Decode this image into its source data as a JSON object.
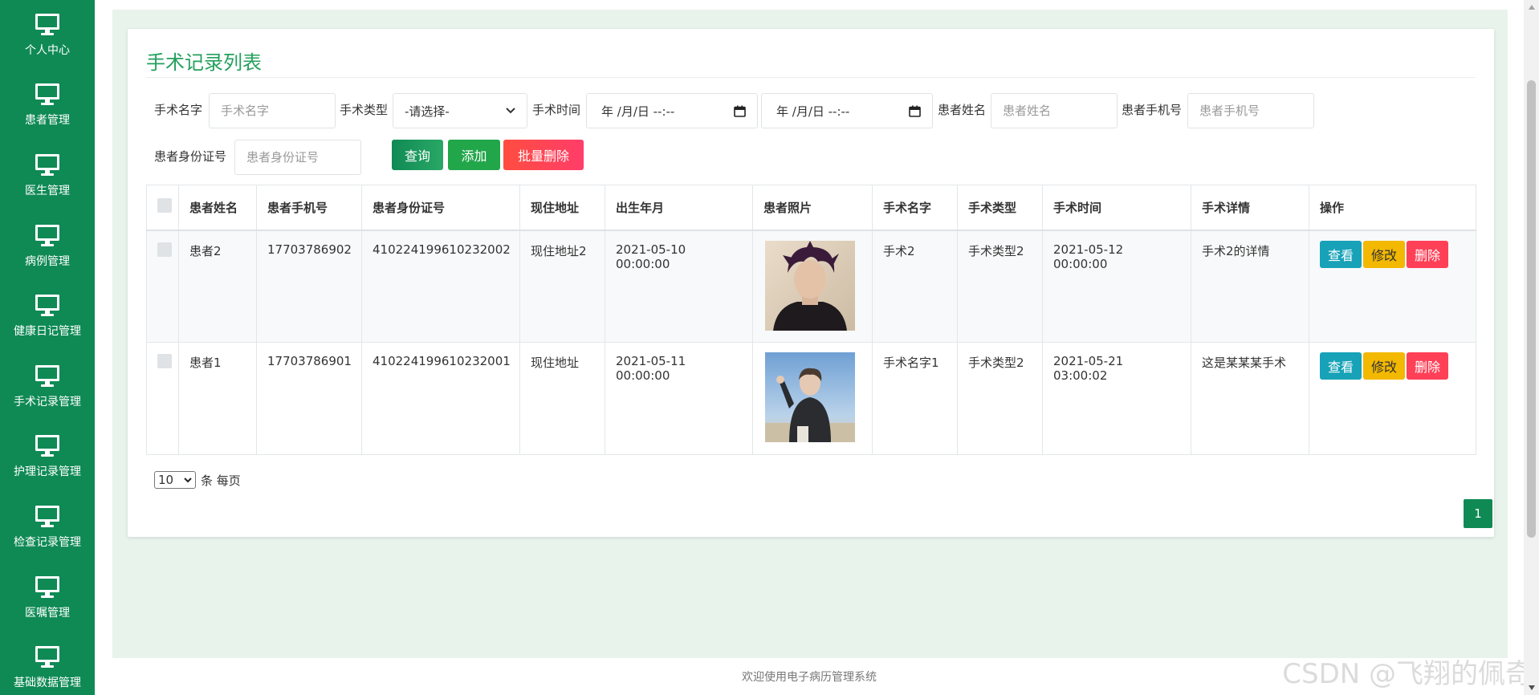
{
  "sidebar": {
    "items": [
      {
        "label": "个人中心"
      },
      {
        "label": "患者管理"
      },
      {
        "label": "医生管理"
      },
      {
        "label": "病例管理"
      },
      {
        "label": "健康日记管理"
      },
      {
        "label": "手术记录管理"
      },
      {
        "label": "护理记录管理"
      },
      {
        "label": "检查记录管理"
      },
      {
        "label": "医嘱管理"
      },
      {
        "label": "基础数据管理"
      }
    ]
  },
  "page": {
    "title": "手术记录列表"
  },
  "filters": {
    "surgery_name": {
      "label": "手术名字",
      "placeholder": "手术名字"
    },
    "surgery_type": {
      "label": "手术类型",
      "value": "-请选择-"
    },
    "surgery_time": {
      "label": "手术时间",
      "start_value": "年 /月/日 --:--",
      "end_value": "年 /月/日 --:--"
    },
    "patient_name": {
      "label": "患者姓名",
      "placeholder": "患者姓名"
    },
    "patient_phone": {
      "label": "患者手机号",
      "placeholder": "患者手机号"
    },
    "patient_id": {
      "label": "患者身份证号",
      "placeholder": "患者身份证号"
    }
  },
  "actions": {
    "query": "查询",
    "add": "添加",
    "batch_delete": "批量删除"
  },
  "table": {
    "columns": [
      "患者姓名",
      "患者手机号",
      "患者身份证号",
      "现住地址",
      "出生年月",
      "患者照片",
      "手术名字",
      "手术类型",
      "手术时间",
      "手术详情",
      "操作"
    ],
    "rows": [
      {
        "name": "患者2",
        "phone": "17703786902",
        "id_card": "410224199610232002",
        "address": "现住地址2",
        "birth": "2021-05-10 00:00:00",
        "surgery_name": "手术2",
        "surgery_type": "手术类型2",
        "surgery_time": "2021-05-12 00:00:00",
        "detail": "手术2的详情"
      },
      {
        "name": "患者1",
        "phone": "17703786901",
        "id_card": "410224199610232001",
        "address": "现住地址",
        "birth": "2021-05-11 00:00:00",
        "surgery_name": "手术名字1",
        "surgery_type": "手术类型2",
        "surgery_time": "2021-05-21 03:00:02",
        "detail": "这是某某某手术"
      }
    ],
    "row_actions": {
      "view": "查看",
      "edit": "修改",
      "delete": "删除"
    }
  },
  "pagination": {
    "page_size": "10",
    "page_size_suffix": "条 每页",
    "current_page": "1"
  },
  "footer": {
    "text": "欢迎使用电子病历管理系统"
  },
  "watermark": "CSDN @飞翔的佩奇",
  "colors": {
    "brand_green": "#0f8a55",
    "title_green": "#24a05e",
    "view": "#17a2b8",
    "edit": "#f3b800",
    "delete": "#ff4057"
  }
}
